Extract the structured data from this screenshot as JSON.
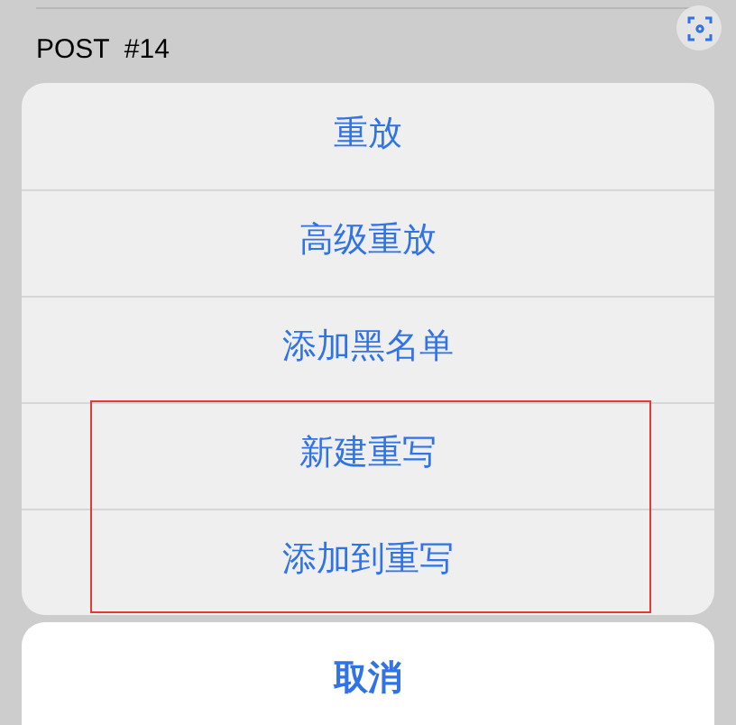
{
  "background": {
    "title": "POST  #14"
  },
  "action_sheet": {
    "items": [
      {
        "label": "重放",
        "highlighted": false
      },
      {
        "label": "高级重放",
        "highlighted": false
      },
      {
        "label": "添加黑名单",
        "highlighted": false
      },
      {
        "label": "新建重写",
        "highlighted": true
      },
      {
        "label": "添加到重写",
        "highlighted": true
      }
    ]
  },
  "cancel_button": {
    "label": "取消"
  }
}
